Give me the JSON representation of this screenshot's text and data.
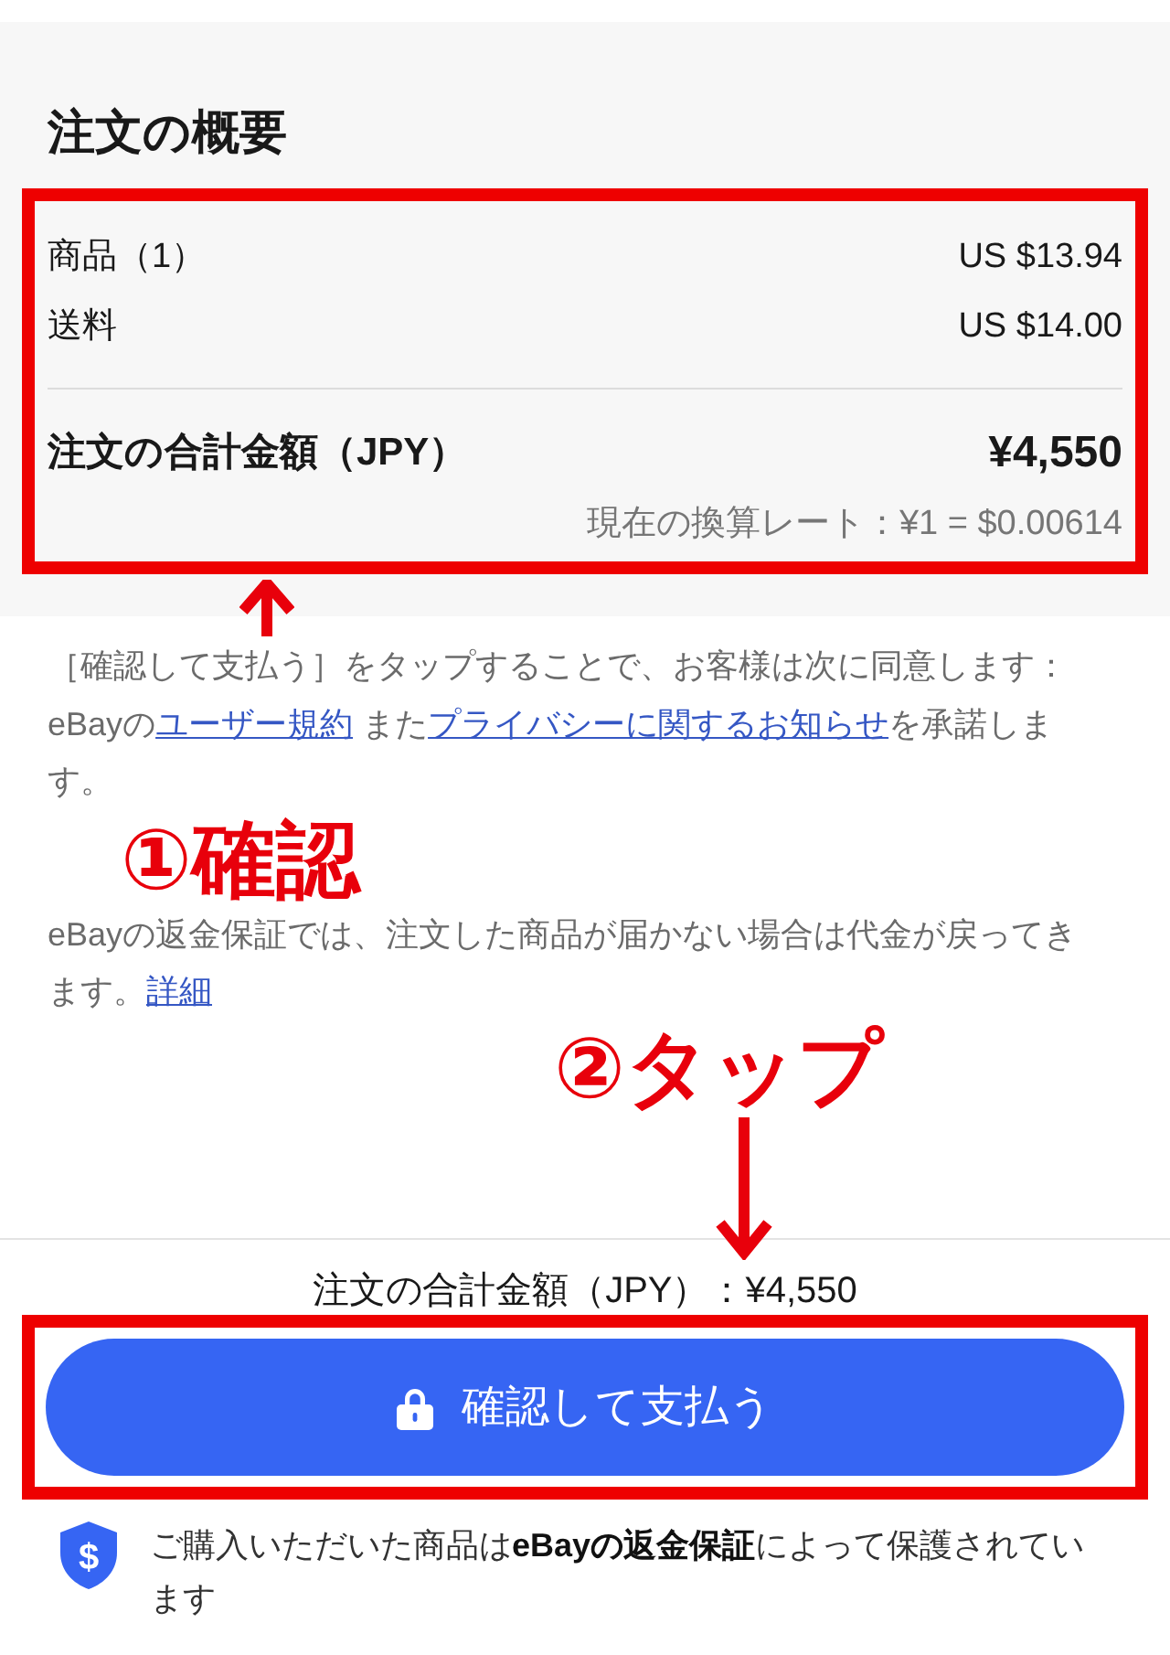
{
  "summary": {
    "title": "注文の概要",
    "highlighted": true,
    "lines": [
      {
        "label": "商品（1）",
        "amount": "US $13.94"
      },
      {
        "label": "送料",
        "amount": "US $14.00"
      }
    ],
    "total": {
      "label": "注文の合計金額（JPY）",
      "amount": "¥4,550"
    },
    "exchange_rate": "現在の換算レート：¥1 = $0.00614"
  },
  "notices": [
    {
      "parts": [
        {
          "kind": "text",
          "text": "［確認して支払う］をタップすることで、お客様は次に同意します：eBayの"
        },
        {
          "kind": "link",
          "text": "ユーザー規約"
        },
        {
          "kind": "text",
          "text": " また"
        },
        {
          "kind": "link",
          "text": "プライバシーに関するお知らせ"
        },
        {
          "kind": "text",
          "text": "を承諾します。"
        }
      ]
    },
    {
      "parts": [
        {
          "kind": "text",
          "text": "eBayの返金保証では、注文した商品が届かない場合は代金が戻ってきます。"
        },
        {
          "kind": "link",
          "text": "詳細"
        }
      ]
    }
  ],
  "checkout_bar": {
    "total": "注文の合計金額（JPY）：¥4,550",
    "pay_button": {
      "label": "確認して支払う",
      "highlighted": true
    },
    "guarantee_symbol": "$",
    "guarantee": "ご購入いただいた商品は**eBayの返金保証**によって保護されています"
  },
  "annotations": [
    {
      "text": "①確認",
      "kind": "up"
    },
    {
      "text": "②タップ",
      "kind": "down"
    }
  ]
}
